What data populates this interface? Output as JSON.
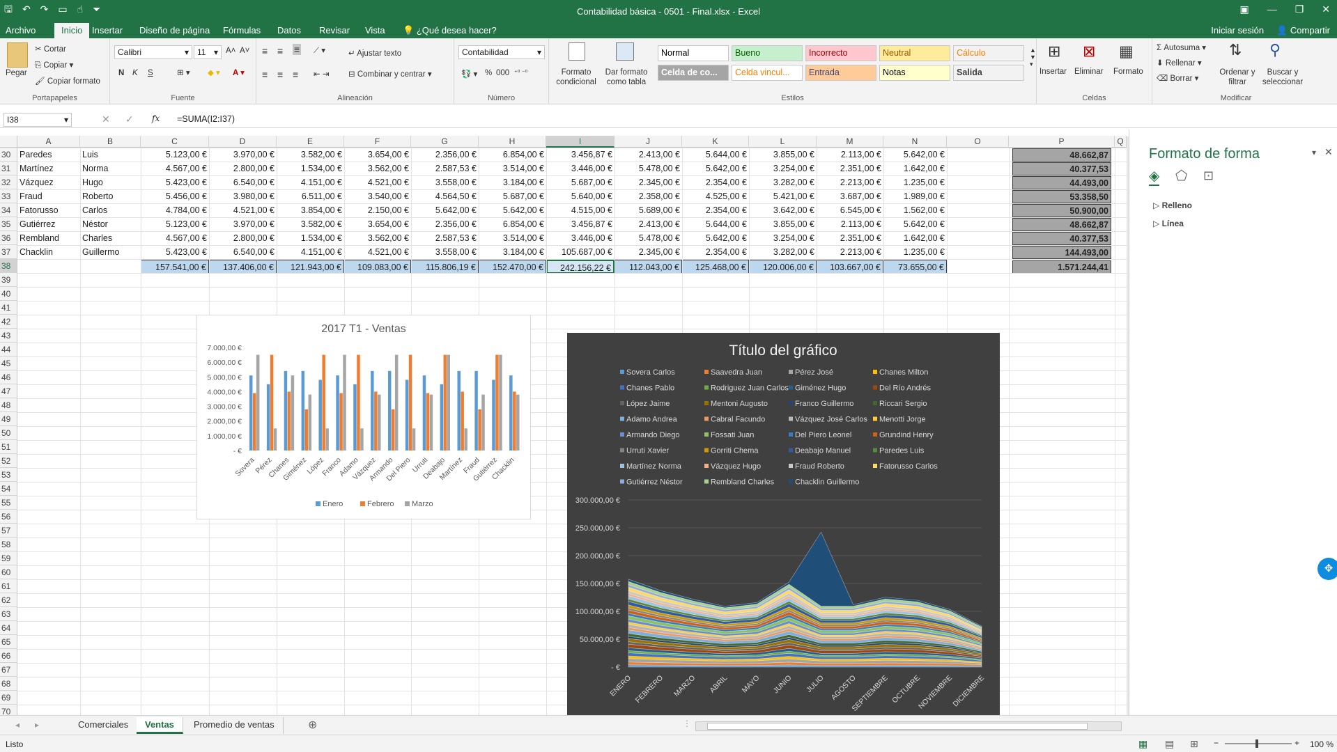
{
  "window": {
    "title": "Contabilidad básica - 0501 - Final.xlsx - Excel"
  },
  "ribbon_tabs": [
    "Archivo",
    "Inicio",
    "Insertar",
    "Diseño de página",
    "Fórmulas",
    "Datos",
    "Revisar",
    "Vista"
  ],
  "tell_me": "¿Qué desea hacer?",
  "signin": "Iniciar sesión",
  "share": "Compartir",
  "clipboard": {
    "paste": "Pegar",
    "cut": "Cortar",
    "copy": "Copiar",
    "format_painter": "Copiar formato",
    "label": "Portapapeles"
  },
  "font": {
    "name": "Calibri",
    "size": "11",
    "bold": "N",
    "italic": "K",
    "underline": "S",
    "label": "Fuente"
  },
  "alignment": {
    "wrap": "Ajustar texto",
    "merge": "Combinar y centrar",
    "label": "Alineación"
  },
  "number": {
    "format": "Contabilidad",
    "label": "Número"
  },
  "styles_group": {
    "cond": "Formato condicional",
    "table": "Dar formato como tabla",
    "label": "Estilos",
    "cells": [
      {
        "label": "Normal",
        "bg": "#ffffff",
        "fg": "#000000"
      },
      {
        "label": "Bueno",
        "bg": "#c6efce",
        "fg": "#006100"
      },
      {
        "label": "Incorrecto",
        "bg": "#ffc7ce",
        "fg": "#9c0006"
      },
      {
        "label": "Neutral",
        "bg": "#ffeb9c",
        "fg": "#9c5700"
      },
      {
        "label": "Cálculo",
        "bg": "#f2f2f2",
        "fg": "#fa7d00"
      },
      {
        "label": "Celda de co...",
        "bg": "#a5a5a5",
        "fg": "#ffffff"
      },
      {
        "label": "Celda vincul...",
        "bg": "#ffffff",
        "fg": "#fa7d00"
      },
      {
        "label": "Entrada",
        "bg": "#ffcc99",
        "fg": "#3f3f76"
      },
      {
        "label": "Notas",
        "bg": "#ffffcc",
        "fg": "#000000"
      },
      {
        "label": "Salida",
        "bg": "#f2f2f2",
        "fg": "#3f3f3f"
      }
    ]
  },
  "cells_group": {
    "insert": "Insertar",
    "delete": "Eliminar",
    "format": "Formato",
    "label": "Celdas"
  },
  "editing": {
    "autosum": "Autosuma",
    "fill": "Rellenar",
    "clear": "Borrar",
    "sort": "Ordenar y filtrar",
    "find": "Buscar y seleccionar",
    "label": "Modificar"
  },
  "formula_bar": {
    "namebox": "I38",
    "formula": "=SUMA(I2:I37)",
    "fx": "fx"
  },
  "columns": [
    "A",
    "B",
    "C",
    "D",
    "E",
    "F",
    "G",
    "H",
    "I",
    "J",
    "K",
    "L",
    "M",
    "N",
    "O",
    "P",
    "Q"
  ],
  "rows": [
    {
      "n": "30",
      "a": "Paredes",
      "b": "Luis",
      "v": [
        "5.123,00 €",
        "3.970,00 €",
        "3.582,00 €",
        "3.654,00 €",
        "2.356,00 €",
        "6.854,00 €",
        "3.456,87 €",
        "2.413,00 €",
        "5.644,00 €",
        "3.855,00 €",
        "2.113,00 €",
        "5.642,00 €"
      ],
      "p": "48.662,87"
    },
    {
      "n": "31",
      "a": "Martínez",
      "b": "Norma",
      "v": [
        "4.567,00 €",
        "2.800,00 €",
        "1.534,00 €",
        "3.562,00 €",
        "2.587,53 €",
        "3.514,00 €",
        "3.446,00 €",
        "5.478,00 €",
        "5.642,00 €",
        "3.254,00 €",
        "2.351,00 €",
        "1.642,00 €"
      ],
      "p": "40.377,53"
    },
    {
      "n": "32",
      "a": "Vázquez",
      "b": "Hugo",
      "v": [
        "5.423,00 €",
        "6.540,00 €",
        "4.151,00 €",
        "4.521,00 €",
        "3.558,00 €",
        "3.184,00 €",
        "5.687,00 €",
        "2.345,00 €",
        "2.354,00 €",
        "3.282,00 €",
        "2.213,00 €",
        "1.235,00 €"
      ],
      "p": "44.493,00"
    },
    {
      "n": "33",
      "a": "Fraud",
      "b": "Roberto",
      "v": [
        "5.456,00 €",
        "3.980,00 €",
        "6.511,00 €",
        "3.540,00 €",
        "4.564,50 €",
        "5.687,00 €",
        "5.640,00 €",
        "2.358,00 €",
        "4.525,00 €",
        "5.421,00 €",
        "3.687,00 €",
        "1.989,00 €"
      ],
      "p": "53.358,50"
    },
    {
      "n": "34",
      "a": "Fatorusso",
      "b": "Carlos",
      "v": [
        "4.784,00 €",
        "4.521,00 €",
        "3.854,00 €",
        "2.150,00 €",
        "5.642,00 €",
        "5.642,00 €",
        "4.515,00 €",
        "5.689,00 €",
        "2.354,00 €",
        "3.642,00 €",
        "6.545,00 €",
        "1.562,00 €"
      ],
      "p": "50.900,00"
    },
    {
      "n": "35",
      "a": "Gutiérrez",
      "b": "Néstor",
      "v": [
        "5.123,00 €",
        "3.970,00 €",
        "3.582,00 €",
        "3.654,00 €",
        "2.356,00 €",
        "6.854,00 €",
        "3.456,87 €",
        "2.413,00 €",
        "5.644,00 €",
        "3.855,00 €",
        "2.113,00 €",
        "5.642,00 €"
      ],
      "p": "48.662,87"
    },
    {
      "n": "36",
      "a": "Rembland",
      "b": "Charles",
      "v": [
        "4.567,00 €",
        "2.800,00 €",
        "1.534,00 €",
        "3.562,00 €",
        "2.587,53 €",
        "3.514,00 €",
        "3.446,00 €",
        "5.478,00 €",
        "5.642,00 €",
        "3.254,00 €",
        "2.351,00 €",
        "1.642,00 €"
      ],
      "p": "40.377,53"
    },
    {
      "n": "37",
      "a": "Chacklin",
      "b": "Guillermo",
      "v": [
        "5.423,00 €",
        "6.540,00 €",
        "4.151,00 €",
        "4.521,00 €",
        "3.558,00 €",
        "3.184,00 €",
        "105.687,00 €",
        "2.345,00 €",
        "2.354,00 €",
        "3.282,00 €",
        "2.213,00 €",
        "1.235,00 €"
      ],
      "p": "144.493,00"
    }
  ],
  "totals": {
    "n": "38",
    "v": [
      "157.541,00 €",
      "137.406,00 €",
      "121.943,00 €",
      "109.083,00 €",
      "115.806,19 €",
      "152.470,00 €",
      "242.156,22 €",
      "112.043,00 €",
      "125.468,00 €",
      "120.006,00 €",
      "103.667,00 €",
      "73.655,00 €"
    ],
    "p": "1.571.244,41"
  },
  "empty_rows": [
    "39",
    "40",
    "41",
    "42",
    "43",
    "44",
    "45",
    "46",
    "47",
    "48",
    "49",
    "50",
    "51",
    "52",
    "53",
    "54",
    "55",
    "56",
    "57",
    "58",
    "59",
    "60",
    "61",
    "62",
    "63",
    "64",
    "65",
    "66",
    "67",
    "68",
    "69",
    "70"
  ],
  "chart1": {
    "title": "2017 T1 - Ventas",
    "yticks": [
      "7.000,00 €",
      "6.000,00 €",
      "5.000,00 €",
      "4.000,00 €",
      "3.000,00 €",
      "2.000,00 €",
      "1.000,00 €",
      "-  €"
    ],
    "categories": [
      "Sovera",
      "Pérez",
      "Chanes",
      "Giménez",
      "López",
      "Franco",
      "Adamo",
      "Vázquez",
      "Armando",
      "Del Piero",
      "Urruti",
      "Deabajo",
      "Martínez",
      "Fraud",
      "Gutiérrez",
      "Chacklin"
    ],
    "legend": [
      "Enero",
      "Febrero",
      "Marzo"
    ],
    "colors": [
      "#5b9bd5",
      "#ed7d31",
      "#a5a5a5"
    ]
  },
  "chart2": {
    "title": "Título del gráfico",
    "legend": [
      "Sovera Carlos",
      "Saavedra Juan",
      "Pérez José",
      "Chanes Milton",
      "Chanes Pablo",
      "Rodriguez Juan Carlos",
      "Giménez Hugo",
      "Del Río Andrés",
      "López Jaime",
      "Mentoni Augusto",
      "Franco Guillermo",
      "Riccari Sergio",
      "Adamo Andrea",
      "Cabral Facundo",
      "Vázquez José Carlos",
      "Menotti Jorge",
      "Armando Diego",
      "Fossati Juan",
      "Del Piero Leonel",
      "Grundind Henry",
      "Urruti Xavier",
      "Gorriti Chema",
      "Deabajo Manuel",
      "Paredes Luis",
      "Martínez Norma",
      "Vázquez Hugo",
      "Fraud Roberto",
      "Fatorusso Carlos",
      "Gutiérrez Néstor",
      "Rembland Charles",
      "Chacklin Guillermo"
    ],
    "yticks": [
      "300.000,00 €",
      "250.000,00 €",
      "200.000,00 €",
      "150.000,00 €",
      "100.000,00 €",
      "50.000,00 €",
      "-  €"
    ],
    "months": [
      "ENERO",
      "FEBRERO",
      "MARZO",
      "ABRIL",
      "MAYO",
      "JUNIO",
      "JULIO",
      "AGOSTO",
      "SEPTIEMBRE",
      "OCTUBRE",
      "NOVIEMBRE",
      "DICIEMBRE"
    ]
  },
  "chart_data": [
    {
      "type": "bar",
      "title": "2017 T1 - Ventas",
      "categories": [
        "Sovera",
        "Pérez",
        "Chanes",
        "Giménez",
        "López",
        "Franco",
        "Adamo",
        "Vázquez",
        "Armando",
        "Del Piero",
        "Urruti",
        "Deabajo",
        "Martínez",
        "Fraud",
        "Gutiérrez",
        "Chacklin"
      ],
      "series": [
        {
          "name": "Enero",
          "values": [
            5100,
            4500,
            5400,
            5400,
            4800,
            5100,
            4500,
            5400,
            5400,
            4800,
            5100,
            4500,
            5400,
            5400,
            4800,
            5100
          ]
        },
        {
          "name": "Febrero",
          "values": [
            3900,
            6500,
            4000,
            2800,
            6500,
            3900,
            6500,
            4000,
            2800,
            6500,
            3900,
            6500,
            4000,
            2800,
            6500,
            4000
          ]
        },
        {
          "name": "Marzo",
          "values": [
            6500,
            1500,
            5100,
            3800,
            1500,
            6500,
            1500,
            3800,
            6500,
            1500,
            3800,
            6500,
            1500,
            3800,
            6500,
            3800
          ]
        }
      ],
      "ylim": [
        0,
        7000
      ],
      "legend_position": "bottom"
    },
    {
      "type": "area",
      "title": "Título del gráfico",
      "categories": [
        "ENERO",
        "FEBRERO",
        "MARZO",
        "ABRIL",
        "MAYO",
        "JUNIO",
        "JULIO",
        "AGOSTO",
        "SEPTIEMBRE",
        "OCTUBRE",
        "NOVIEMBRE",
        "DICIEMBRE"
      ],
      "totals": [
        157541,
        137406,
        121943,
        109083,
        115806,
        152470,
        242156,
        112043,
        125468,
        120006,
        103667,
        73655
      ],
      "ylim": [
        0,
        300000
      ],
      "legend_position": "top"
    }
  ],
  "pane": {
    "title": "Formato de forma",
    "fill": "Relleno",
    "line": "Línea"
  },
  "sheets": [
    "Comerciales",
    "Ventas",
    "Promedio de ventas"
  ],
  "status": {
    "ready": "Listo",
    "zoom": "100 %"
  }
}
